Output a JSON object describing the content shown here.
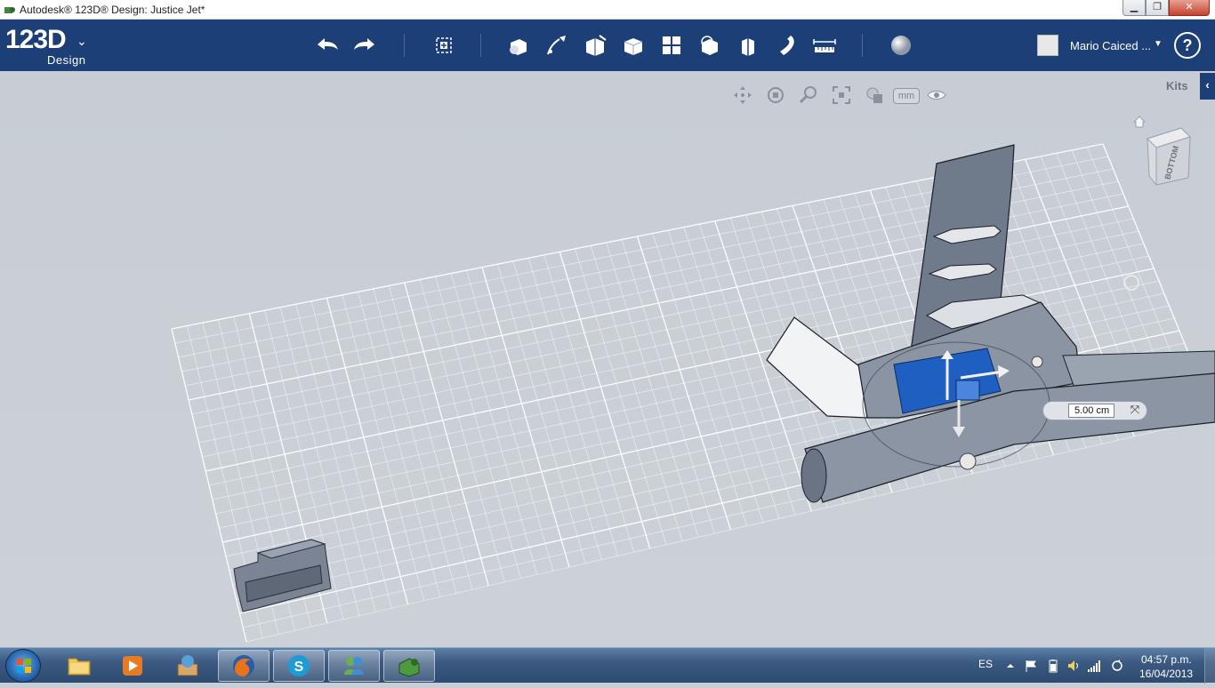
{
  "window": {
    "title": "Autodesk® 123D® Design: Justice Jet*",
    "minimize_label": "▁",
    "maximize_label": "❐",
    "close_label": "✕"
  },
  "toolbar": {
    "logo_text": "123D",
    "logo_subtitle": "Design",
    "logo_dropdown": "⌄",
    "items": [
      {
        "name": "undo-button",
        "icon": "undo-icon"
      },
      {
        "name": "redo-button",
        "icon": "redo-icon"
      },
      {
        "name": "transform-button",
        "icon": "transform-icon"
      },
      {
        "name": "primitives-button",
        "icon": "primitives-icon"
      },
      {
        "name": "sketch-button",
        "icon": "sketch-icon"
      },
      {
        "name": "construct-button",
        "icon": "construct-icon"
      },
      {
        "name": "modify-button",
        "icon": "modify-icon"
      },
      {
        "name": "pattern-button",
        "icon": "pattern-icon"
      },
      {
        "name": "group-button",
        "icon": "group-icon"
      },
      {
        "name": "combine-button",
        "icon": "combine-icon"
      },
      {
        "name": "snap-button",
        "icon": "snap-icon"
      },
      {
        "name": "measure-button",
        "icon": "ruler-icon"
      },
      {
        "name": "material-button",
        "icon": "material-sphere-icon"
      }
    ],
    "user_name": "Mario Caiced ...",
    "user_dropdown": "▼",
    "help_label": "?"
  },
  "viewport": {
    "kits_label": "Kits",
    "kits_tab_arrow": "‹",
    "unit_label": "mm",
    "viewcube_face": "BOTTOM",
    "measure_value": "5.00 cm",
    "measure_tool_glyph": "⤧",
    "accent_color": "#1f5fc2",
    "body_color": "#7b8595"
  },
  "taskbar": {
    "language": "ES",
    "time": "04:57 p.m.",
    "date": "16/04/2013",
    "apps": [
      {
        "name": "explorer-task",
        "icon": "folder-icon"
      },
      {
        "name": "media-player-task",
        "icon": "media-player-icon"
      },
      {
        "name": "archive-task",
        "icon": "archive-icon"
      },
      {
        "name": "firefox-task",
        "icon": "firefox-icon"
      },
      {
        "name": "skype-task",
        "icon": "skype-icon"
      },
      {
        "name": "messenger-task",
        "icon": "messenger-icon"
      },
      {
        "name": "123d-design-task",
        "icon": "123d-design-icon"
      }
    ]
  }
}
